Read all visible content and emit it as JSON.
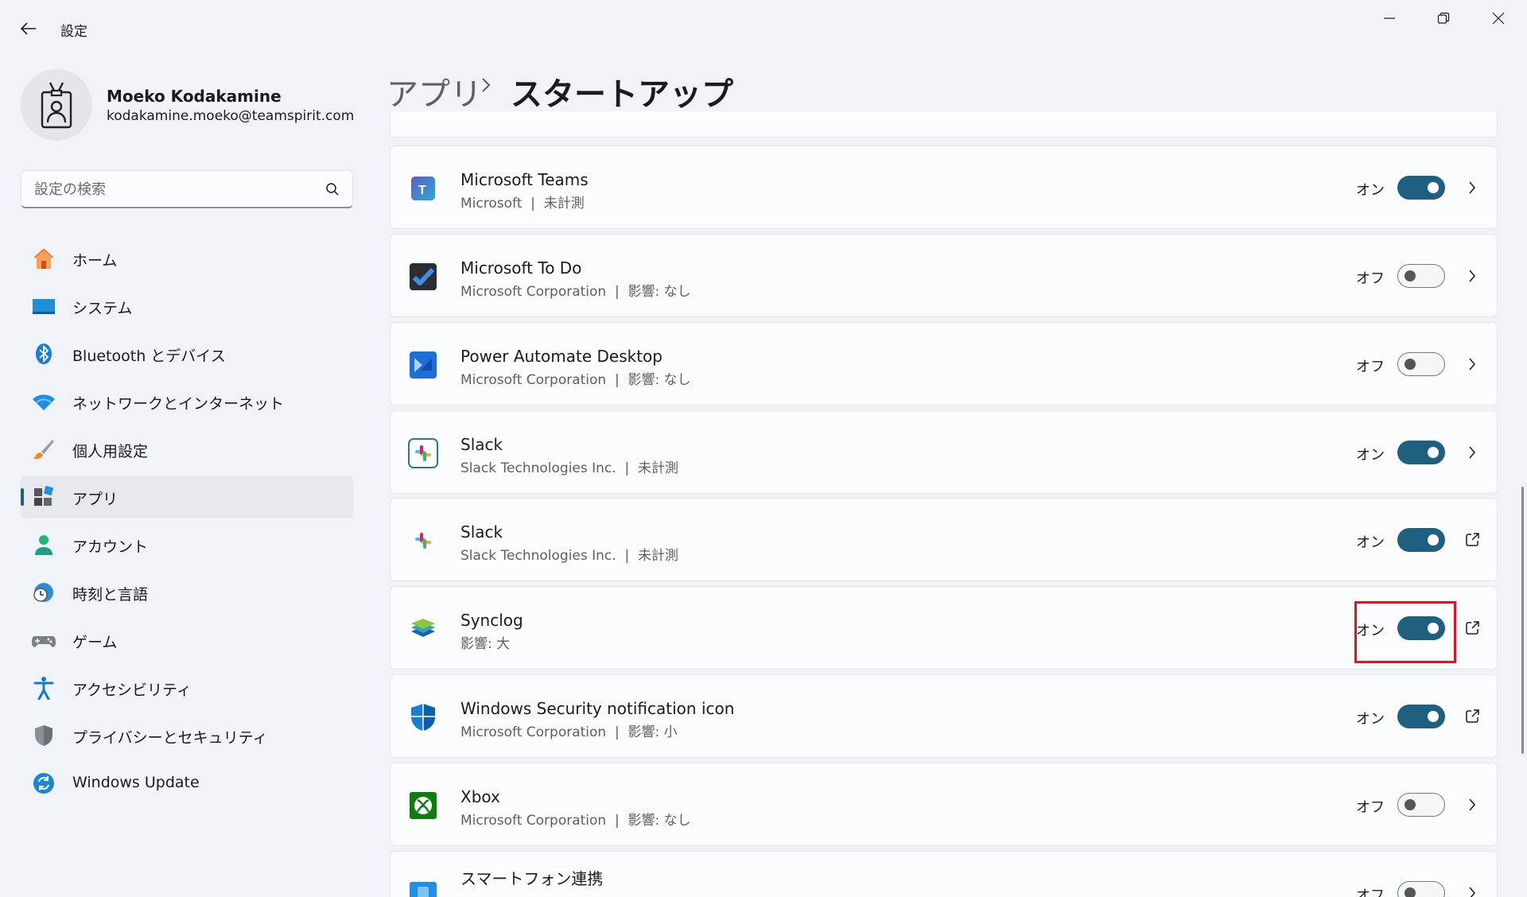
{
  "window": {
    "title": "設定",
    "back_icon": "arrow-left-icon",
    "minimize_icon": "minimize-icon",
    "maximize_icon": "restore-icon",
    "close_icon": "close-icon"
  },
  "profile": {
    "name": "Moeko Kodakamine",
    "email": "kodakamine.moeko@teamspirit.com",
    "avatar_icon": "user-badge-icon"
  },
  "search": {
    "placeholder": "設定の検索",
    "value": "",
    "icon": "search-icon"
  },
  "sidebar": {
    "items": [
      {
        "label": "ホーム",
        "icon": "home-icon",
        "active": false
      },
      {
        "label": "システム",
        "icon": "monitor-icon",
        "active": false
      },
      {
        "label": "Bluetooth とデバイス",
        "icon": "bluetooth-icon",
        "active": false
      },
      {
        "label": "ネットワークとインターネット",
        "icon": "wifi-icon",
        "active": false
      },
      {
        "label": "個人用設定",
        "icon": "brush-icon",
        "active": false
      },
      {
        "label": "アプリ",
        "icon": "apps-icon",
        "active": true
      },
      {
        "label": "アカウント",
        "icon": "account-icon",
        "active": false
      },
      {
        "label": "時刻と言語",
        "icon": "globe-clock-icon",
        "active": false
      },
      {
        "label": "ゲーム",
        "icon": "gamepad-icon",
        "active": false
      },
      {
        "label": "アクセシビリティ",
        "icon": "accessibility-icon",
        "active": false
      },
      {
        "label": "プライバシーとセキュリティ",
        "icon": "shield-icon",
        "active": false
      },
      {
        "label": "Windows Update",
        "icon": "windows-update-icon",
        "active": false
      }
    ]
  },
  "header": {
    "parent": "アプリ",
    "separator_icon": "chevron-right-icon",
    "current": "スタートアップ"
  },
  "startup_apps": [
    {
      "name": "Microsoft Teams",
      "publisher": "Microsoft",
      "impact": "未計測",
      "state": "オン",
      "enabled": true,
      "action_icon": "chevron-right-icon",
      "icon": "teams-icon"
    },
    {
      "name": "Microsoft To Do",
      "publisher": "Microsoft Corporation",
      "impact": "影響: なし",
      "state": "オフ",
      "enabled": false,
      "action_icon": "chevron-right-icon",
      "icon": "todo-icon"
    },
    {
      "name": "Power Automate Desktop",
      "publisher": "Microsoft Corporation",
      "impact": "影響: なし",
      "state": "オフ",
      "enabled": false,
      "action_icon": "chevron-right-icon",
      "icon": "power-automate-icon"
    },
    {
      "name": "Slack",
      "publisher": "Slack Technologies Inc.",
      "impact": "未計測",
      "state": "オン",
      "enabled": true,
      "action_icon": "chevron-right-icon",
      "icon": "slack-icon"
    },
    {
      "name": "Slack",
      "publisher": "Slack Technologies Inc.",
      "impact": "未計測",
      "state": "オン",
      "enabled": true,
      "action_icon": "open-external-icon",
      "icon": "slack-icon"
    },
    {
      "name": "Synclog",
      "publisher": "",
      "impact": "影響: 大",
      "state": "オン",
      "enabled": true,
      "action_icon": "open-external-icon",
      "icon": "synclog-icon",
      "highlighted": true
    },
    {
      "name": "Windows Security notification icon",
      "publisher": "Microsoft Corporation",
      "impact": "影響: 小",
      "state": "オン",
      "enabled": true,
      "action_icon": "open-external-icon",
      "icon": "windows-security-icon"
    },
    {
      "name": "Xbox",
      "publisher": "Microsoft Corporation",
      "impact": "影響: なし",
      "state": "オフ",
      "enabled": false,
      "action_icon": "chevron-right-icon",
      "icon": "xbox-icon"
    },
    {
      "name": "スマートフォン連携",
      "publisher": "",
      "impact": "",
      "state": "オフ",
      "enabled": false,
      "action_icon": "chevron-right-icon",
      "icon": "phone-link-icon"
    }
  ],
  "colors": {
    "accent": "#1f5f7f",
    "highlight_box": "#e0141e",
    "background": "#f0f4f9"
  }
}
